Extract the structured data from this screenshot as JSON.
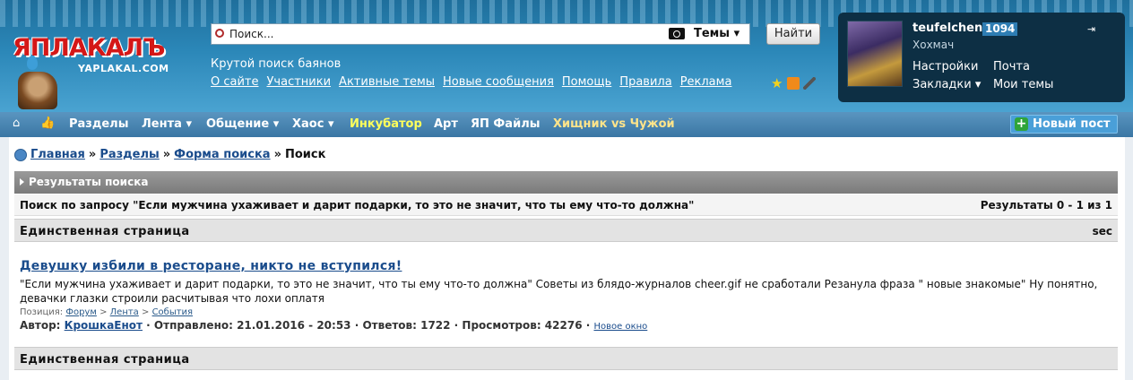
{
  "logo": {
    "main": "ЯПЛАКАЛЪ",
    "sub": "YAPLAKAL.COM"
  },
  "search": {
    "value": "Поиск...",
    "scope": "Темы",
    "button": "Найти",
    "hint": "Крутой поиск баянов"
  },
  "top_links": [
    "О сайте",
    "Участники",
    "Активные темы",
    "Новые сообщения",
    "Помощь",
    "Правила",
    "Реклама"
  ],
  "user": {
    "name": "teufelchen",
    "rating": "1094",
    "status": "Хохмач",
    "menu": {
      "settings": "Настройки",
      "mail": "Почта",
      "bookmarks": "Закладки",
      "my_topics": "Мои темы"
    }
  },
  "nav": {
    "items": [
      {
        "label": "Разделы"
      },
      {
        "label": "Лента"
      },
      {
        "label": "Общение"
      },
      {
        "label": "Хаос"
      },
      {
        "label": "Инкубатор"
      },
      {
        "label": "Арт"
      },
      {
        "label": "ЯП Файлы"
      },
      {
        "label": "Хищник vs Чужой"
      }
    ],
    "new_post": "Новый пост"
  },
  "breadcrumb": {
    "home": "Главная",
    "sections": "Разделы",
    "search_form": "Форма поиска",
    "current": "Поиск",
    "sep": "»"
  },
  "results": {
    "header": "Результаты поиска",
    "query": "Поиск по запросу \"Если мужчина ухаживает и дарит подарки, то это не значит, что ты ему что-то должна\"",
    "count": "Результаты 0 - 1 из 1",
    "page_label": "Единственная страница",
    "sec": "sec"
  },
  "result": {
    "title": "Девушку избили в ресторане, никто не вступился!",
    "snippet": "\"Если мужчина ухаживает и дарит подарки, то это не значит, что ты ему что-то должна\" Советы из блядо-журналов cheer.gif не сработали Резанула фраза \" новые знакомые\" Ну понятно, девачки глазки строили расчитывая что лохи оплатя",
    "position_label": "Позиция:",
    "position": [
      "Форум",
      "Лента",
      "События"
    ],
    "author_label": "Автор:",
    "author": "КрошкаЕнот",
    "sent": "· Отправлено: 21.01.2016 - 20:53 · Ответов: 1722 · Просмотров: 42276 ·",
    "new_window": "Новое окно"
  }
}
